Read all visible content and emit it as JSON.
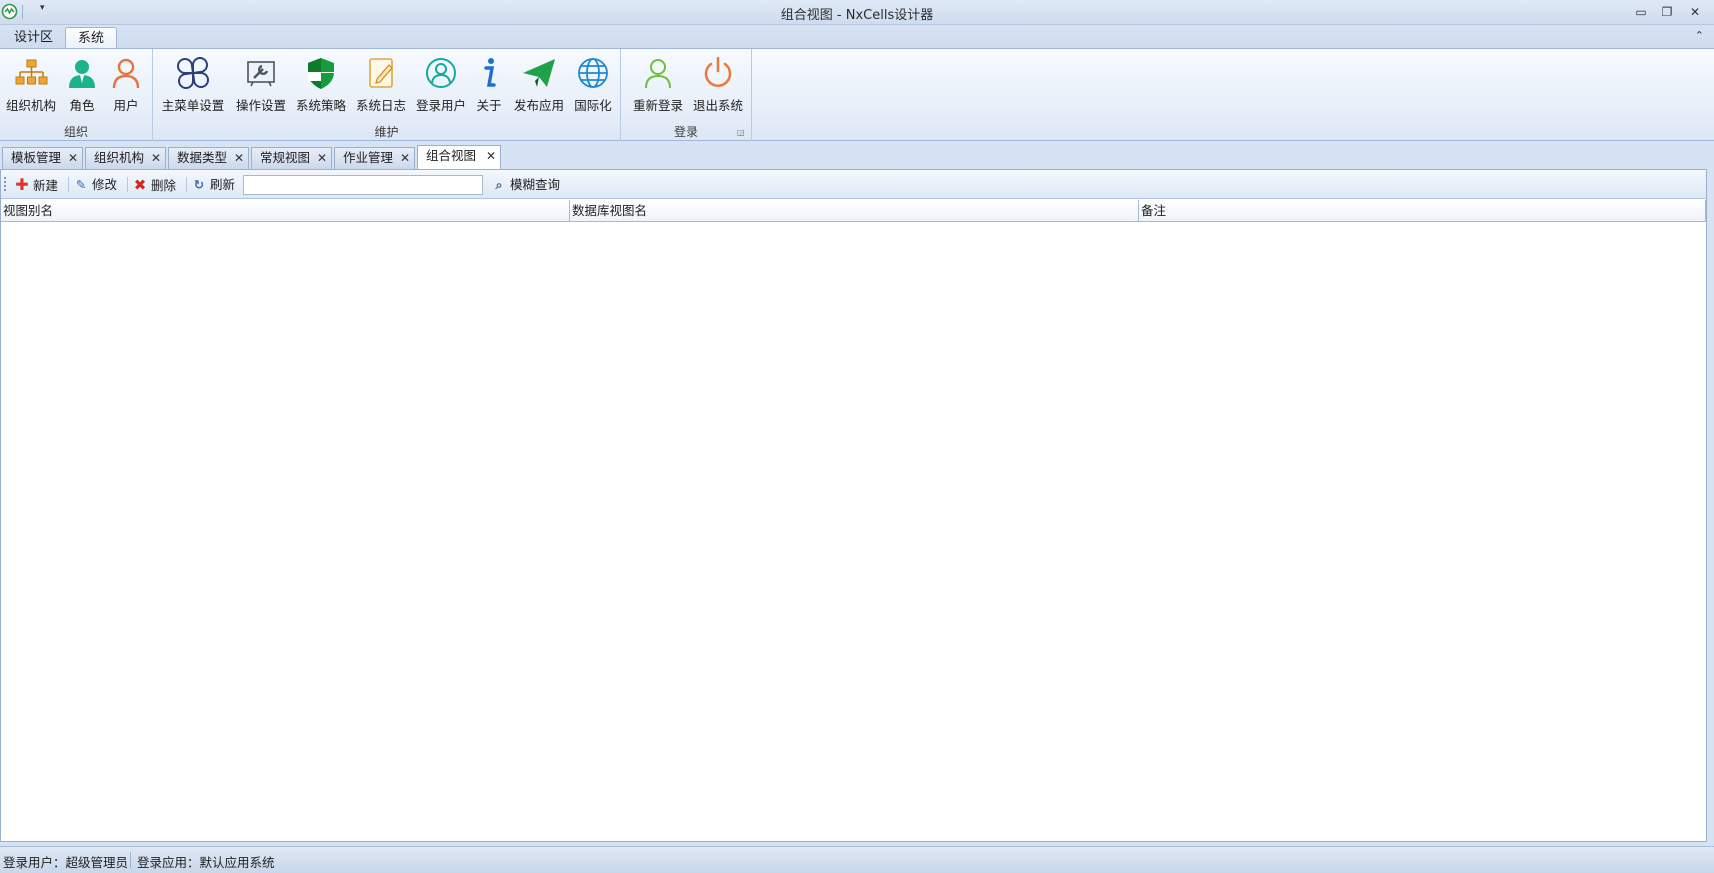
{
  "window": {
    "title": "组合视图 - NxCells设计器",
    "qat_dropdown": "▾",
    "minimize": "▭",
    "restore": "❐",
    "close": "✕"
  },
  "ribbon": {
    "tabs": [
      {
        "label": "设计区",
        "active": false
      },
      {
        "label": "系统",
        "active": true
      }
    ],
    "collapse_glyph": "⌃",
    "groups": [
      {
        "label": "组织",
        "buttons": [
          {
            "label": "组织机构",
            "icon": "org-chart-icon"
          },
          {
            "label": "角色",
            "icon": "role-icon"
          },
          {
            "label": "用户",
            "icon": "user-icon"
          }
        ]
      },
      {
        "label": "维护",
        "buttons": [
          {
            "label": "主菜单设置",
            "icon": "menu-settings-icon"
          },
          {
            "label": "操作设置",
            "icon": "operation-settings-icon"
          },
          {
            "label": "系统策略",
            "icon": "shield-icon"
          },
          {
            "label": "系统日志",
            "icon": "log-icon"
          },
          {
            "label": "登录用户",
            "icon": "logged-user-icon"
          },
          {
            "label": "关于",
            "icon": "info-icon"
          },
          {
            "label": "发布应用",
            "icon": "paper-plane-icon"
          },
          {
            "label": "国际化",
            "icon": "globe-icon"
          }
        ]
      },
      {
        "label": "登录",
        "buttons": [
          {
            "label": "重新登录",
            "icon": "relogin-icon"
          },
          {
            "label": "退出系统",
            "icon": "power-icon"
          }
        ]
      }
    ]
  },
  "doc_tabs": [
    {
      "label": "模板管理",
      "active": false
    },
    {
      "label": "组织机构",
      "active": false
    },
    {
      "label": "数据类型",
      "active": false
    },
    {
      "label": "常规视图",
      "active": false
    },
    {
      "label": "作业管理",
      "active": false
    },
    {
      "label": "组合视图",
      "active": true
    }
  ],
  "doc_tab_close": "✕",
  "toolbar": {
    "new_label": "新建",
    "edit_label": "修改",
    "delete_label": "删除",
    "refresh_label": "刷新",
    "search_value": "",
    "search_placeholder": "",
    "fuzzy_query_label": "模糊查询"
  },
  "grid": {
    "columns": [
      "视图别名",
      "数据库视图名",
      "备注"
    ],
    "rows": []
  },
  "status": {
    "login_user": "登录用户：超级管理员",
    "login_app": "登录应用：默认应用系统"
  },
  "colors": {
    "accent": "#2f6fba",
    "ribbon_bg": "#e9f0f9",
    "frame": "#d6e3f3"
  }
}
